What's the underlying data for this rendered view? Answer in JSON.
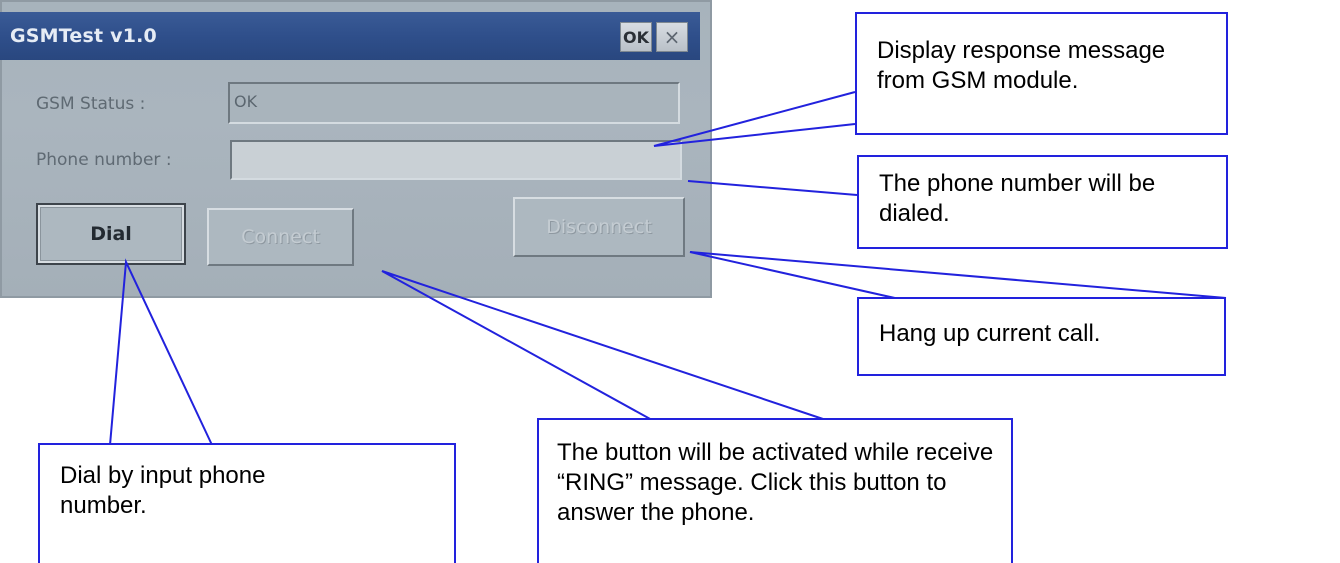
{
  "window": {
    "title": "GSMTest v1.0",
    "ok_label": "OK",
    "close_glyph": "×"
  },
  "form": {
    "status_label": "GSM Status :",
    "status_value": "OK",
    "phone_label": "Phone number :",
    "phone_value": ""
  },
  "buttons": {
    "dial": "Dial",
    "connect": "Connect",
    "disconnect": "Disconnect"
  },
  "callouts": {
    "status": "Display response message from GSM module.",
    "phone": "The phone number will be dialed.",
    "disconnect": "Hang up current call.",
    "dial": "Dial by input phone number.",
    "connect": "The button will be activated while receive “RING” message. Click this button to answer the phone."
  },
  "colors": {
    "callout_border": "#2222dd",
    "titlebar": "#2f4f8b",
    "window_bg": "#a7b3bc"
  }
}
